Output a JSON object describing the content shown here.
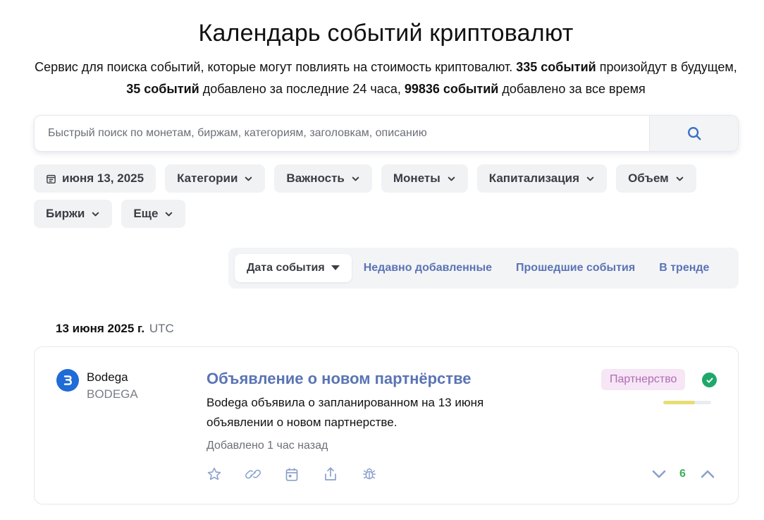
{
  "header": {
    "title": "Календарь событий криптовалют",
    "subtitle_p1": "Сервис для поиска событий, которые могут повлиять на стоимость криптовалют. ",
    "subtitle_b1": "335 событий",
    "subtitle_p2": " произойдут в будущем, ",
    "subtitle_b2": "35 событий",
    "subtitle_p3": " добавлено за последние 24 часа, ",
    "subtitle_b3": "99836 событий",
    "subtitle_p4": " добавлено за все время"
  },
  "search": {
    "placeholder": "Быстрый поиск по монетам, биржам, категориям, заголовкам, описанию",
    "button_icon": "search-icon"
  },
  "filters": [
    {
      "label": "июня 13, 2025",
      "icon": "calendar-icon"
    },
    {
      "label": "Категории"
    },
    {
      "label": "Важность"
    },
    {
      "label": "Монеты"
    },
    {
      "label": "Капитализация"
    },
    {
      "label": "Объем"
    },
    {
      "label": "Биржи"
    },
    {
      "label": "Еще"
    }
  ],
  "sort_tabs": [
    {
      "label": "Дата события",
      "active": true
    },
    {
      "label": "Недавно добавленные"
    },
    {
      "label": "Прошедшие события"
    },
    {
      "label": "В тренде"
    }
  ],
  "date_group": {
    "date": "13 июня 2025 г.",
    "timezone": "UTC"
  },
  "event": {
    "coin_name": "Bodega",
    "coin_symbol": "BODEGA",
    "title": "Объявление о новом партнёрстве",
    "description": "Bodega объявила о запланированном на 13 июня объявлении о новом партнерстве.",
    "added": "Добавлено 1 час назад",
    "category": "Партнерство",
    "confidence": 0.66,
    "votes": "6",
    "colors": {
      "coin_logo": "#1f6bd8",
      "title": "#5a74b4",
      "tag_bg": "#f6e6f6",
      "tag_text": "#b06cb0",
      "verified": "#1ea86a",
      "bar_fill": "#e8dc74",
      "votes": "#3fae5c"
    },
    "actions": [
      "star-icon",
      "link-icon",
      "calendar-icon",
      "share-icon",
      "bug-icon"
    ]
  }
}
